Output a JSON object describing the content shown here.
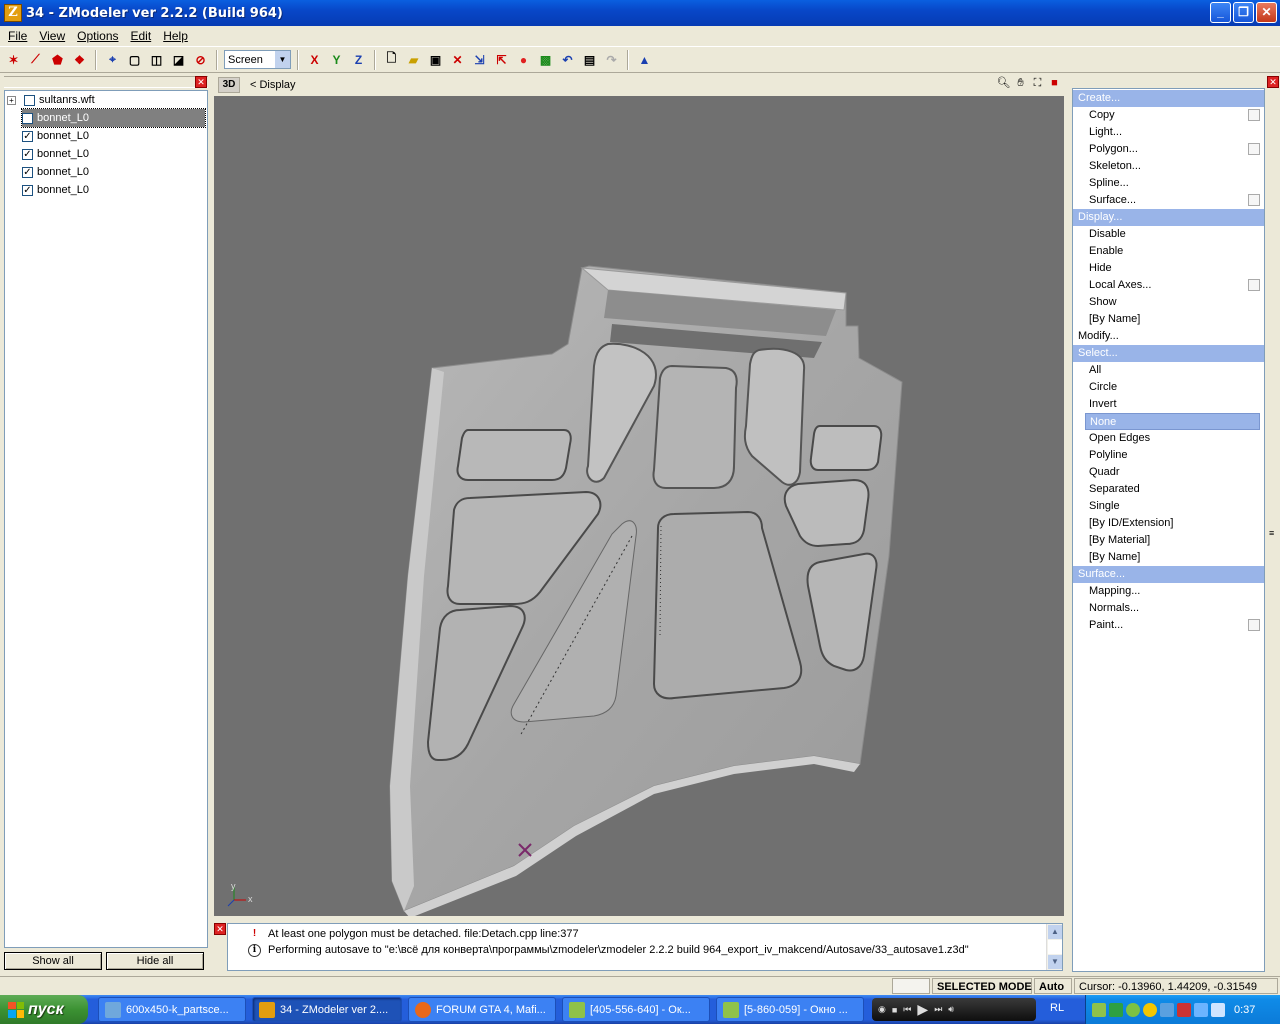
{
  "window": {
    "title": "34 - ZModeler ver 2.2.2 (Build 964)",
    "app_icon_letter": "Z"
  },
  "menu": [
    {
      "label": "File"
    },
    {
      "label": "View"
    },
    {
      "label": "Options"
    },
    {
      "label": "Edit"
    },
    {
      "label": "Help"
    }
  ],
  "toolbar": {
    "view_select_value": "Screen",
    "axis_x": "X",
    "axis_y": "Y",
    "axis_z": "Z"
  },
  "tree": {
    "root": {
      "label": "sultanrs.wft",
      "checked": false
    },
    "items": [
      {
        "label": "bonnet_L0",
        "checked": false,
        "selected": true
      },
      {
        "label": "bonnet_L0",
        "checked": true
      },
      {
        "label": "bonnet_L0",
        "checked": true
      },
      {
        "label": "bonnet_L0",
        "checked": true
      },
      {
        "label": "bonnet_L0",
        "checked": true
      }
    ]
  },
  "left_buttons": {
    "show_all": "Show all",
    "hide_all": "Hide all"
  },
  "viewport": {
    "mode_label": "3D",
    "title": "< Display",
    "axis_x": "x",
    "axis_y": "y"
  },
  "log": [
    {
      "type": "error",
      "text": "At least one polygon must be detached. file:Detach.cpp line:377"
    },
    {
      "type": "info",
      "text": "Performing autosave to \"e:\\всё для конверта\\программы\\zmodeler\\zmodeler 2.2.2 build 964_export_iv_makcend/Autosave/33_autosave1.z3d\""
    }
  ],
  "commands": [
    {
      "label": "Create...",
      "kind": "category"
    },
    {
      "label": "Copy",
      "kind": "sub",
      "box": true
    },
    {
      "label": "Light...",
      "kind": "sub"
    },
    {
      "label": "Polygon...",
      "kind": "sub",
      "box": true
    },
    {
      "label": "Skeleton...",
      "kind": "sub"
    },
    {
      "label": "Spline...",
      "kind": "sub"
    },
    {
      "label": "Surface...",
      "kind": "sub",
      "box": true
    },
    {
      "label": "Display...",
      "kind": "category"
    },
    {
      "label": "Disable",
      "kind": "sub"
    },
    {
      "label": "Enable",
      "kind": "sub"
    },
    {
      "label": "Hide",
      "kind": "sub"
    },
    {
      "label": "Local Axes...",
      "kind": "sub",
      "box": true
    },
    {
      "label": "Show",
      "kind": "sub"
    },
    {
      "label": "[By Name]",
      "kind": "sub"
    },
    {
      "label": "Modify...",
      "kind": "category-plain"
    },
    {
      "label": "Select...",
      "kind": "category"
    },
    {
      "label": "All",
      "kind": "sub"
    },
    {
      "label": "Circle",
      "kind": "sub"
    },
    {
      "label": "Invert",
      "kind": "sub"
    },
    {
      "label": "None",
      "kind": "selected"
    },
    {
      "label": "Open Edges",
      "kind": "sub"
    },
    {
      "label": "Polyline",
      "kind": "sub"
    },
    {
      "label": "Quadr",
      "kind": "sub"
    },
    {
      "label": "Separated",
      "kind": "sub"
    },
    {
      "label": "Single",
      "kind": "sub"
    },
    {
      "label": "[By ID/Extension]",
      "kind": "sub"
    },
    {
      "label": "[By Material]",
      "kind": "sub"
    },
    {
      "label": "[By Name]",
      "kind": "sub"
    },
    {
      "label": "Surface...",
      "kind": "category"
    },
    {
      "label": "Mapping...",
      "kind": "sub"
    },
    {
      "label": "Normals...",
      "kind": "sub"
    },
    {
      "label": "Paint...",
      "kind": "sub",
      "box": true
    }
  ],
  "status": {
    "mode": "SELECTED MODE",
    "auto": "Auto",
    "cursor": "Cursor: -0.13960, 1.44209, -0.31549"
  },
  "taskbar": {
    "start": "пуск",
    "buttons": [
      {
        "label": "600x450-k_partsce...",
        "active": false,
        "icon_color": "#6fa8dc"
      },
      {
        "label": "34 - ZModeler ver 2....",
        "active": true,
        "icon_color": "#e39e10"
      },
      {
        "label": "FORUM GTA 4, Mafi...",
        "active": false,
        "icon_color": "#e8681a"
      },
      {
        "label": "[405-556-640] - Ок...",
        "active": false,
        "icon_color": "#8fc24a"
      },
      {
        "label": "[5-860-059] - Окно ...",
        "active": false,
        "icon_color": "#8fc24a"
      }
    ],
    "lang": "RL",
    "clock": "0:37"
  },
  "colors": {
    "viewport_bg": "#707070",
    "mesh": "#a8a8a8",
    "category_bg": "#99b4e8",
    "titlebar": "#0847c8"
  }
}
